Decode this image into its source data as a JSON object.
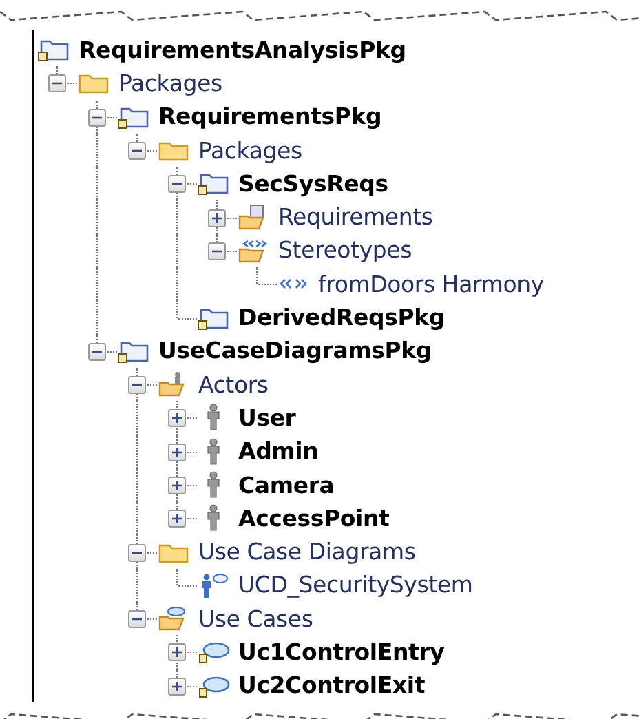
{
  "tree": [
    {
      "label": "RequirementsAnalysisPkg",
      "kind": "package",
      "children": [
        {
          "label": "Packages",
          "kind": "folder",
          "expanded": true,
          "children": [
            {
              "label": "RequirementsPkg",
              "kind": "package",
              "expanded": true,
              "children": [
                {
                  "label": "Packages",
                  "kind": "folder",
                  "expanded": true,
                  "children": [
                    {
                      "label": "SecSysReqs",
                      "kind": "package",
                      "expanded": true,
                      "children": [
                        {
                          "label": "Requirements",
                          "kind": "requirements-folder",
                          "expanded": false
                        },
                        {
                          "label": "Stereotypes",
                          "kind": "stereotypes-folder",
                          "expanded": true,
                          "children": [
                            {
                              "label": "fromDoors Harmony",
                              "kind": "stereotype"
                            }
                          ]
                        }
                      ]
                    },
                    {
                      "label": "DerivedReqsPkg",
                      "kind": "package"
                    }
                  ]
                }
              ]
            },
            {
              "label": "UseCaseDiagramsPkg",
              "kind": "package",
              "expanded": true,
              "children": [
                {
                  "label": "Actors",
                  "kind": "actors-folder",
                  "expanded": true,
                  "children": [
                    {
                      "label": "User",
                      "kind": "actor",
                      "expanded": false
                    },
                    {
                      "label": "Admin",
                      "kind": "actor",
                      "expanded": false
                    },
                    {
                      "label": "Camera",
                      "kind": "actor",
                      "expanded": false
                    },
                    {
                      "label": "AccessPoint",
                      "kind": "actor",
                      "expanded": false
                    }
                  ]
                },
                {
                  "label": "Use Case Diagrams",
                  "kind": "folder",
                  "expanded": true,
                  "children": [
                    {
                      "label": "UCD_SecuritySystem",
                      "kind": "diagram"
                    }
                  ]
                },
                {
                  "label": "Use Cases",
                  "kind": "usecases-folder",
                  "expanded": true,
                  "children": [
                    {
                      "label": "Uc1ControlEntry",
                      "kind": "usecase",
                      "expanded": false
                    },
                    {
                      "label": "Uc2ControlExit",
                      "kind": "usecase",
                      "expanded": false
                    }
                  ]
                }
              ]
            }
          ]
        }
      ]
    }
  ]
}
